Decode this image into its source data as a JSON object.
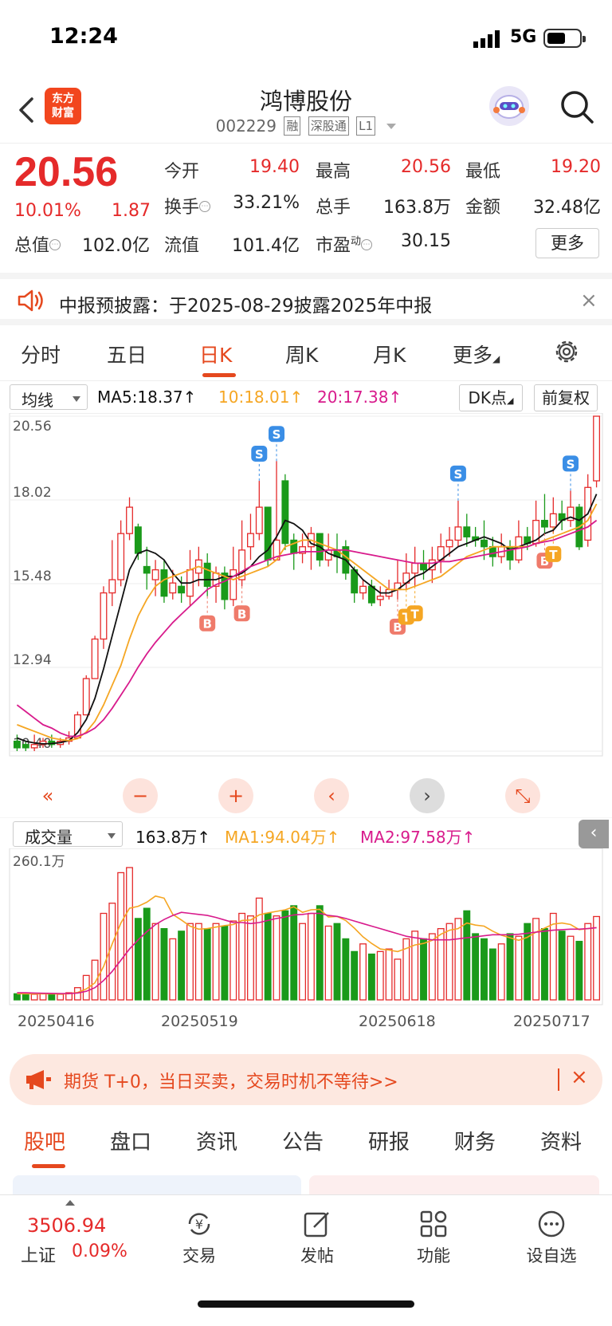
{
  "status_bar": {
    "time": "12:24",
    "network": "5G"
  },
  "header": {
    "brand": "东方财富",
    "stock_name": "鸿博股份",
    "stock_code": "002229",
    "tags": [
      "融",
      "深股通",
      "L1"
    ]
  },
  "quote": {
    "price": "20.56",
    "change_pct": "10.01%",
    "change": "1.87",
    "fields": [
      {
        "label": "今开",
        "value": "19.40"
      },
      {
        "label": "最高",
        "value": "20.56"
      },
      {
        "label": "最低",
        "value": "19.20"
      },
      {
        "label": "换手",
        "value": "33.21%"
      },
      {
        "label": "总手",
        "value": "163.8万"
      },
      {
        "label": "金额",
        "value": "32.48亿"
      },
      {
        "label": "总值",
        "value": "102.0亿"
      },
      {
        "label": "流值",
        "value": "101.4亿"
      },
      {
        "label": "市盈",
        "value": "30.15"
      }
    ],
    "pe_superscript": "动",
    "more_label": "更多"
  },
  "notice": {
    "text": "中报预披露：于2025-08-29披露2025年中报"
  },
  "chart_tabs": [
    "分时",
    "五日",
    "日K",
    "周K",
    "月K",
    "更多"
  ],
  "ma_bar": {
    "selector": "均线",
    "ma5": "MA5:18.37↑",
    "ma10": "10:18.01↑",
    "ma20": "20:17.38↑",
    "dk_label": "DK点",
    "adjust_label": "前复权"
  },
  "colors": {
    "up": "#e52a2a",
    "down": "#1a9a1a",
    "ma5": "#111111",
    "ma10": "#f5a623",
    "ma20": "#d81b8c",
    "accent": "#e5481e"
  },
  "kline": {
    "y_ticks": [
      "20.56",
      "18.02",
      "15.48",
      "12.94",
      "10.40"
    ],
    "markers": {
      "buy": "B",
      "sell": "S",
      "t": "T"
    }
  },
  "volume_bar": {
    "selector": "成交量",
    "vol": "163.8万↑",
    "ma1": "MA1:94.04万↑",
    "ma2": "MA2:97.58万↑",
    "top_label": "260.1万"
  },
  "dates": [
    "20250416",
    "20250519",
    "20250618",
    "20250717"
  ],
  "chart_data": {
    "type": "candlestick",
    "y_range": [
      10.4,
      20.56
    ],
    "candles": [
      [
        10.7,
        10.5,
        10.9,
        10.4
      ],
      [
        10.6,
        10.5,
        10.7,
        10.4
      ],
      [
        10.5,
        10.6,
        10.9,
        10.4
      ],
      [
        10.6,
        10.7,
        10.8,
        10.5
      ],
      [
        10.7,
        10.6,
        10.9,
        10.5
      ],
      [
        10.6,
        10.7,
        10.8,
        10.5
      ],
      [
        10.7,
        10.8,
        11.0,
        10.6
      ],
      [
        10.8,
        11.5,
        11.6,
        10.8
      ],
      [
        11.5,
        12.6,
        12.7,
        11.5
      ],
      [
        12.6,
        13.8,
        13.9,
        12.6
      ],
      [
        13.8,
        15.2,
        15.4,
        13.5
      ],
      [
        15.2,
        15.6,
        16.8,
        14.8
      ],
      [
        15.6,
        17.0,
        17.4,
        15.4
      ],
      [
        17.0,
        17.8,
        18.1,
        16.8
      ],
      [
        17.2,
        16.4,
        17.3,
        16.2
      ],
      [
        16.0,
        15.8,
        16.6,
        15.3
      ],
      [
        15.6,
        15.9,
        16.2,
        15.1
      ],
      [
        15.9,
        15.1,
        16.2,
        14.9
      ],
      [
        15.2,
        15.5,
        15.9,
        15.0
      ],
      [
        15.4,
        15.2,
        15.7,
        14.9
      ],
      [
        15.1,
        15.9,
        16.5,
        14.8
      ],
      [
        15.8,
        16.2,
        16.6,
        15.4
      ],
      [
        16.1,
        15.4,
        16.4,
        15.1
      ],
      [
        15.4,
        15.8,
        16.0,
        14.9
      ],
      [
        15.8,
        15.0,
        16.0,
        14.7
      ],
      [
        15.0,
        15.9,
        16.6,
        14.8
      ],
      [
        15.6,
        16.5,
        17.4,
        15.4
      ],
      [
        16.6,
        17.0,
        17.6,
        16.2
      ],
      [
        17.0,
        17.8,
        18.6,
        16.8
      ],
      [
        17.8,
        16.2,
        17.8,
        16.0
      ],
      [
        16.2,
        16.8,
        19.2,
        16.2
      ],
      [
        18.6,
        16.7,
        18.8,
        16.5
      ],
      [
        16.8,
        16.4,
        17.0,
        15.9
      ],
      [
        16.4,
        16.6,
        17.0,
        16.1
      ],
      [
        16.6,
        17.0,
        17.2,
        15.9
      ],
      [
        17.0,
        16.2,
        17.0,
        16.0
      ],
      [
        16.2,
        16.5,
        17.0,
        16.0
      ],
      [
        16.5,
        16.3,
        17.0,
        15.8
      ],
      [
        16.6,
        15.8,
        16.8,
        15.6
      ],
      [
        15.9,
        15.2,
        16.0,
        14.9
      ],
      [
        15.2,
        15.4,
        15.6,
        15.0
      ],
      [
        15.4,
        14.9,
        15.6,
        14.8
      ],
      [
        15.0,
        15.1,
        15.4,
        14.8
      ],
      [
        15.1,
        15.3,
        15.6,
        15.0
      ],
      [
        15.3,
        15.5,
        16.2,
        15.0
      ],
      [
        15.5,
        15.8,
        16.4,
        15.3
      ],
      [
        15.8,
        16.1,
        16.6,
        15.4
      ],
      [
        16.1,
        15.9,
        16.5,
        15.6
      ],
      [
        15.9,
        16.2,
        16.6,
        15.5
      ],
      [
        16.2,
        16.6,
        17.0,
        15.8
      ],
      [
        16.6,
        16.8,
        17.2,
        16.3
      ],
      [
        16.8,
        17.2,
        18.0,
        16.6
      ],
      [
        17.2,
        16.9,
        17.6,
        16.6
      ],
      [
        16.9,
        16.8,
        17.2,
        16.6
      ],
      [
        16.8,
        16.6,
        17.4,
        16.2
      ],
      [
        16.6,
        16.3,
        16.9,
        16.0
      ],
      [
        16.3,
        16.6,
        17.0,
        16.1
      ],
      [
        16.6,
        16.2,
        16.8,
        15.9
      ],
      [
        16.2,
        16.9,
        17.4,
        16.1
      ],
      [
        16.9,
        16.7,
        17.2,
        16.5
      ],
      [
        16.7,
        17.4,
        18.0,
        16.6
      ],
      [
        17.4,
        17.2,
        18.2,
        17.0
      ],
      [
        17.2,
        17.6,
        18.1,
        17.0
      ],
      [
        17.6,
        17.4,
        18.0,
        17.1
      ],
      [
        17.4,
        17.8,
        18.3,
        17.2
      ],
      [
        17.8,
        16.6,
        17.9,
        16.5
      ],
      [
        16.8,
        18.4,
        18.8,
        16.6
      ],
      [
        18.6,
        20.56,
        20.56,
        18.4
      ]
    ],
    "ma5": [
      10.8,
      10.7,
      10.65,
      10.62,
      10.63,
      10.66,
      10.72,
      10.96,
      11.36,
      12.0,
      12.9,
      13.9,
      14.9,
      15.9,
      16.4,
      16.5,
      16.4,
      16.2,
      15.8,
      15.5,
      15.5,
      15.6,
      15.6,
      15.6,
      15.7,
      15.7,
      15.8,
      16.0,
      16.3,
      16.5,
      16.9,
      17.4,
      17.3,
      17.1,
      16.7,
      16.6,
      16.4,
      16.3,
      16.2,
      15.9,
      15.6,
      15.4,
      15.2,
      15.2,
      15.3,
      15.5,
      15.7,
      15.8,
      16.0,
      16.2,
      16.4,
      16.6,
      16.7,
      16.8,
      16.9,
      16.8,
      16.7,
      16.5,
      16.6,
      16.7,
      16.8,
      17.0,
      17.1,
      17.4,
      17.5,
      17.4,
      17.6,
      18.2
    ],
    "ma10": [
      11.2,
      11.1,
      11.0,
      10.9,
      10.8,
      10.75,
      10.72,
      10.78,
      10.98,
      11.3,
      11.8,
      12.4,
      13.0,
      13.8,
      14.5,
      15.0,
      15.4,
      15.6,
      15.7,
      15.8,
      15.9,
      16.0,
      15.9,
      15.8,
      15.7,
      15.6,
      15.7,
      15.8,
      15.9,
      16.0,
      16.2,
      16.6,
      16.7,
      16.8,
      16.8,
      16.7,
      16.6,
      16.5,
      16.3,
      16.1,
      15.9,
      15.7,
      15.5,
      15.3,
      15.3,
      15.3,
      15.4,
      15.5,
      15.6,
      15.7,
      15.9,
      16.1,
      16.3,
      16.4,
      16.5,
      16.6,
      16.6,
      16.6,
      16.6,
      16.6,
      16.7,
      16.8,
      16.9,
      17.0,
      17.1,
      17.2,
      17.4,
      17.9
    ],
    "ma20": [
      11.8,
      11.6,
      11.4,
      11.2,
      11.1,
      10.95,
      10.85,
      10.85,
      10.95,
      11.1,
      11.35,
      11.7,
      12.1,
      12.5,
      12.95,
      13.35,
      13.7,
      14.0,
      14.3,
      14.55,
      14.8,
      15.05,
      15.3,
      15.45,
      15.55,
      15.7,
      15.85,
      16.0,
      16.1,
      16.2,
      16.3,
      16.35,
      16.4,
      16.45,
      16.45,
      16.45,
      16.5,
      16.5,
      16.5,
      16.45,
      16.4,
      16.35,
      16.3,
      16.25,
      16.2,
      16.15,
      16.1,
      16.1,
      16.1,
      16.15,
      16.15,
      16.2,
      16.25,
      16.3,
      16.35,
      16.4,
      16.45,
      16.5,
      16.55,
      16.6,
      16.7,
      16.75,
      16.8,
      16.9,
      17.0,
      17.1,
      17.2,
      17.4
    ],
    "volume": [
      12,
      12,
      11,
      12,
      12,
      11,
      14,
      24,
      48,
      78,
      170,
      190,
      250,
      260,
      160,
      180,
      150,
      140,
      120,
      135,
      150,
      150,
      140,
      150,
      145,
      155,
      170,
      165,
      200,
      170,
      165,
      175,
      185,
      150,
      170,
      185,
      145,
      150,
      120,
      95,
      110,
      90,
      95,
      100,
      80,
      120,
      135,
      120,
      130,
      140,
      150,
      160,
      175,
      130,
      120,
      100,
      110,
      130,
      125,
      150,
      160,
      140,
      170,
      135,
      125,
      115,
      150,
      163.8
    ],
    "volume_ma1": [
      12,
      12,
      11.8,
      11.8,
      11.8,
      11.6,
      12,
      14.6,
      21.4,
      33.6,
      65.6,
      110,
      151,
      180,
      184,
      192,
      204,
      200,
      168,
      157,
      145,
      139,
      140,
      143,
      146,
      148,
      156,
      157,
      167,
      171,
      174,
      177,
      183,
      172,
      177,
      178,
      163,
      164,
      156,
      141,
      124,
      111,
      100,
      98,
      95,
      101,
      108,
      111,
      117,
      129,
      137,
      140,
      151,
      147,
      145,
      135,
      127,
      122,
      117,
      123,
      133,
      141,
      149,
      151,
      148,
      138,
      140,
      142
    ],
    "volume_ma2": [
      14,
      14,
      13.5,
      13,
      12.8,
      12.5,
      12.3,
      13.5,
      17,
      24,
      38,
      56,
      78,
      100,
      118,
      134,
      148,
      158,
      166,
      172,
      170,
      168,
      166,
      162,
      157,
      152,
      152,
      150,
      152,
      156,
      160,
      163,
      167,
      168,
      170,
      170,
      166,
      164,
      160,
      155,
      150,
      145,
      140,
      135,
      130,
      125,
      122,
      120,
      118,
      118,
      118,
      120,
      122,
      124,
      126,
      128,
      128,
      128,
      129,
      131,
      133,
      135,
      137,
      138,
      139,
      139,
      140,
      142
    ]
  },
  "ad": {
    "text": "期货 T+0，当日买卖，交易时机不等待>>"
  },
  "bottom_tabs": [
    "股吧",
    "盘口",
    "资讯",
    "公告",
    "研报",
    "财务",
    "资料"
  ],
  "bottom_nav": {
    "index_value": "3506.94",
    "index_name": "上证",
    "index_pct": "0.09%",
    "items": [
      "交易",
      "发帖",
      "功能",
      "设自选"
    ]
  }
}
